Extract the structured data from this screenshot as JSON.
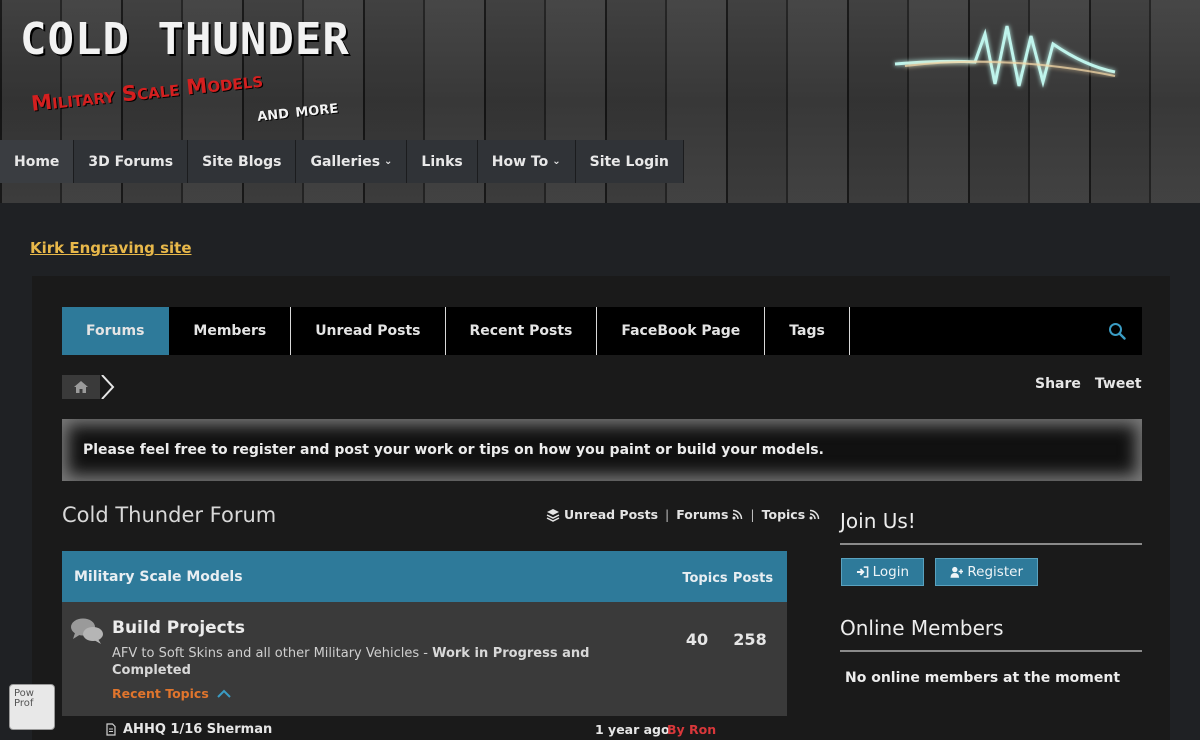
{
  "header": {
    "title": "COLD THUNDER",
    "subtitle": "Military Scale Models",
    "subtitle2": "and more"
  },
  "main_nav": {
    "items": [
      {
        "label": "Home"
      },
      {
        "label": "3D Forums"
      },
      {
        "label": "Site Blogs"
      },
      {
        "label": "Galleries",
        "caret": "⌄"
      },
      {
        "label": "Links"
      },
      {
        "label": "How To",
        "caret": "⌄"
      },
      {
        "label": "Site Login"
      }
    ]
  },
  "engraving_link": "Kirk Engraving site",
  "forum_tabs": [
    {
      "label": "Forums"
    },
    {
      "label": "Members"
    },
    {
      "label": "Unread Posts"
    },
    {
      "label": "Recent Posts"
    },
    {
      "label": "FaceBook Page"
    },
    {
      "label": "Tags"
    }
  ],
  "share": {
    "share_label": "Share",
    "tweet_label": "Tweet"
  },
  "notice": "Please feel free to register and post your work or tips on how you paint or build your models.",
  "forum": {
    "title": "Cold Thunder Forum",
    "links": {
      "unread": "Unread Posts",
      "forums": "Forums",
      "topics": "Topics",
      "sep": "|"
    },
    "category": {
      "name": "Military Scale Models",
      "col_topics": "Topics",
      "col_posts": "Posts"
    },
    "row": {
      "title": "Build Projects",
      "desc": "AFV to Soft Skins and all other Military Vehicles - ",
      "desc_bold": "Work in Progress and Completed",
      "recent_label": "Recent Topics",
      "topics": "40",
      "posts": "258"
    },
    "topic": {
      "title": "AHHQ 1/16 Sherman",
      "time": "1 year ago",
      "by": "By Ron"
    }
  },
  "sidebar": {
    "join_heading": "Join Us!",
    "login_label": "Login",
    "register_label": "Register",
    "online_heading": "Online Members",
    "online_text": "No online members at the moment"
  },
  "broken_image_alt": "Pow Prof"
}
